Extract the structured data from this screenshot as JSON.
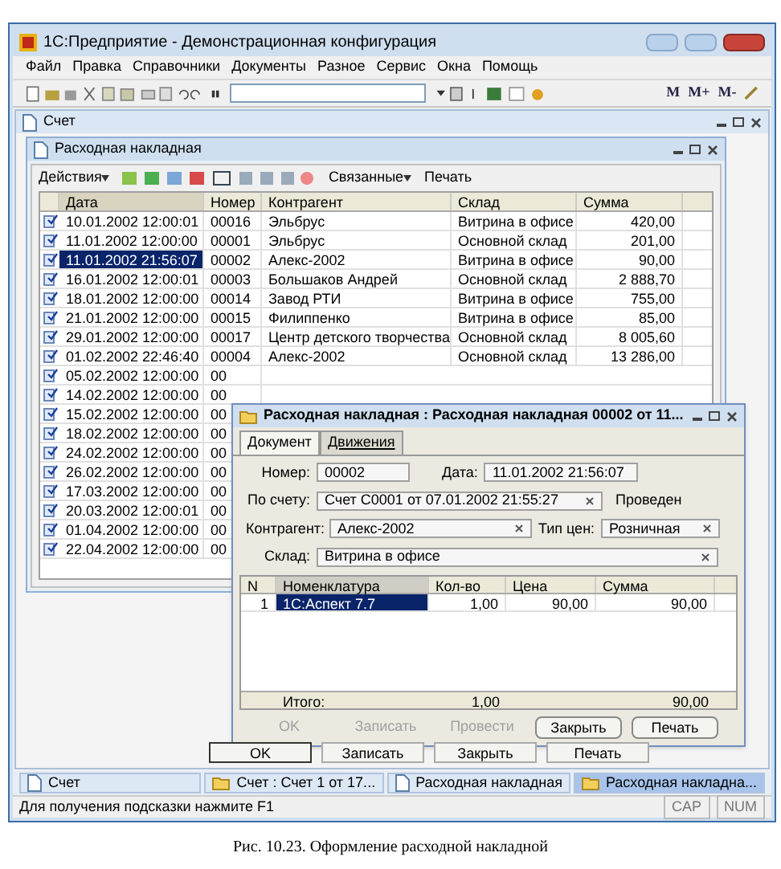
{
  "window": {
    "title": "1С:Предприятие - Демонстрационная конфигурация"
  },
  "memory_buttons": [
    "M",
    "M+",
    "M-"
  ],
  "menu": [
    "Файл",
    "Правка",
    "Справочники",
    "Документы",
    "Разное",
    "Сервис",
    "Окна",
    "Помощь"
  ],
  "invoice_window": {
    "title": "Счет",
    "buttons": [
      {
        "label": "OK",
        "selected": true
      },
      {
        "label": "Записать",
        "selected": false
      },
      {
        "label": "Закрыть",
        "selected": false
      },
      {
        "label": "Печать",
        "selected": false
      }
    ]
  },
  "list_window": {
    "title": "Расходная накладная",
    "actions": "Действия",
    "related": "Связанные",
    "print": "Печать",
    "columns": [
      "Дата",
      "Номер",
      "Контрагент",
      "Склад",
      "Сумма"
    ],
    "rows": [
      {
        "selected": false,
        "cells": [
          "10.01.2002 12:00:01",
          "00016",
          "Эльбрус",
          "Витрина в офисе",
          "420,00"
        ]
      },
      {
        "selected": false,
        "cells": [
          "11.01.2002 12:00:00",
          "00001",
          "Эльбрус",
          "Основной склад",
          "201,00"
        ]
      },
      {
        "selected": true,
        "cells": [
          "11.01.2002 21:56:07",
          "00002",
          "Алекс-2002",
          "Витрина в офисе",
          "90,00"
        ]
      },
      {
        "selected": false,
        "cells": [
          "16.01.2002 12:00:01",
          "00003",
          "Большаков Андрей",
          "Основной склад",
          "2 888,70"
        ]
      },
      {
        "selected": false,
        "cells": [
          "18.01.2002 12:00:00",
          "00014",
          "Завод РТИ",
          "Витрина в офисе",
          "755,00"
        ]
      },
      {
        "selected": false,
        "cells": [
          "21.01.2002 12:00:00",
          "00015",
          "Филиппенко",
          "Витрина в офисе",
          "85,00"
        ]
      },
      {
        "selected": false,
        "cells": [
          "29.01.2002 12:00:00",
          "00017",
          "Центр детского творчества",
          "Основной склад",
          "8 005,60"
        ]
      },
      {
        "selected": false,
        "cells": [
          "01.02.2002 22:46:40",
          "00004",
          "Алекс-2002",
          "Основной склад",
          "13 286,00"
        ]
      },
      {
        "selected": false,
        "cells": [
          "05.02.2002 12:00:00",
          "00"
        ]
      },
      {
        "selected": false,
        "cells": [
          "14.02.2002 12:00:00",
          "00"
        ]
      },
      {
        "selected": false,
        "cells": [
          "15.02.2002 12:00:00",
          "00"
        ]
      },
      {
        "selected": false,
        "cells": [
          "18.02.2002 12:00:00",
          "00"
        ]
      },
      {
        "selected": false,
        "cells": [
          "24.02.2002 12:00:00",
          "00"
        ]
      },
      {
        "selected": false,
        "cells": [
          "26.02.2002 12:00:00",
          "00"
        ]
      },
      {
        "selected": false,
        "cells": [
          "17.03.2002 12:00:00",
          "00"
        ]
      },
      {
        "selected": false,
        "cells": [
          "20.03.2002 12:00:01",
          "00"
        ]
      },
      {
        "selected": false,
        "cells": [
          "01.04.2002 12:00:00",
          "00"
        ]
      },
      {
        "selected": false,
        "cells": [
          "22.04.2002 12:00:00",
          "00"
        ]
      }
    ]
  },
  "document_window": {
    "title": "Расходная накладная : Расходная накладная 00002 от 11...",
    "tabs": [
      {
        "label": "Документ",
        "selected": true
      },
      {
        "label": "Движения",
        "selected": false
      }
    ],
    "number_label": "Номер:",
    "number": "00002",
    "date_label": "Дата:",
    "date": "11.01.2002 21:56:07",
    "invoice_label": "По счету:",
    "invoice": "Счет С0001 от 07.01.2002 21:55:27",
    "status": "Проведен",
    "customer_label": "Контрагент:",
    "customer": "Алекс-2002",
    "price_type_label": "Тип цен:",
    "price_type": "Розничная",
    "warehouse_label": "Склад:",
    "warehouse": "Витрина в офисе",
    "columns": [
      "N",
      "Номенклатура",
      "Кол-во",
      "Цена",
      "Сумма"
    ],
    "items": [
      {
        "selected": true,
        "cells": [
          "1",
          "1С:Аспект 7.7",
          "1,00",
          "90,00",
          "90,00"
        ]
      }
    ],
    "totals": [
      "Итого:",
      "1,00",
      "90,00"
    ],
    "buttons": [
      {
        "label": "OK",
        "disabled": true
      },
      {
        "label": "Записать",
        "disabled": true
      },
      {
        "label": "Провести",
        "disabled": true
      },
      {
        "label": "Закрыть",
        "disabled": false
      },
      {
        "label": "Печать",
        "disabled": false
      }
    ]
  },
  "taskbar": [
    {
      "label": "Счет",
      "kind": "document",
      "selected": false
    },
    {
      "label": "Счет : Счет 1    от 17...",
      "kind": "form",
      "selected": false
    },
    {
      "label": "Расходная накладная",
      "kind": "document",
      "selected": false
    },
    {
      "label": "Расходная накладна...",
      "kind": "form",
      "selected": true
    }
  ],
  "status_bar": {
    "hint": "Для получения подсказки нажмите F1",
    "indicators": [
      "CAP",
      "NUM"
    ]
  },
  "caption": "Рис. 10.23. Оформление расходной накладной"
}
